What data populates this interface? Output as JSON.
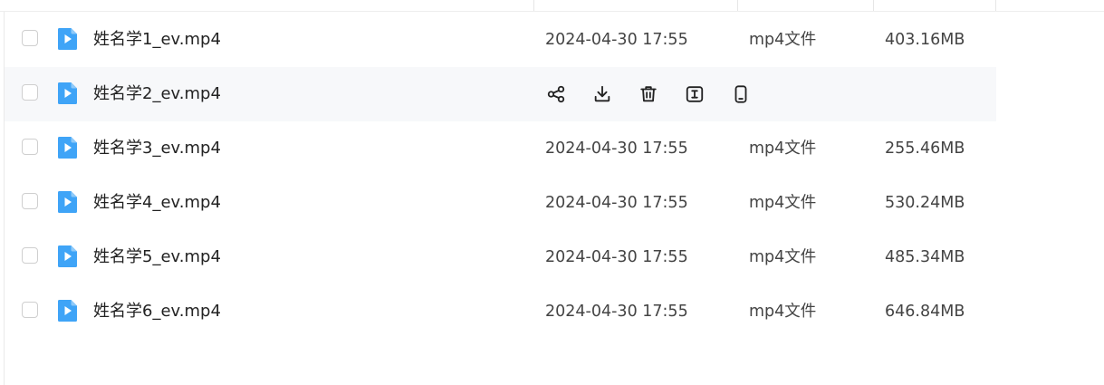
{
  "files": [
    {
      "name": "姓名学1_ev.mp4",
      "date": "2024-04-30 17:55",
      "type": "mp4文件",
      "size": "403.16MB",
      "hovered": false
    },
    {
      "name": "姓名学2_ev.mp4",
      "date": "",
      "type": "",
      "size": "",
      "hovered": true
    },
    {
      "name": "姓名学3_ev.mp4",
      "date": "2024-04-30 17:55",
      "type": "mp4文件",
      "size": "255.46MB",
      "hovered": false
    },
    {
      "name": "姓名学4_ev.mp4",
      "date": "2024-04-30 17:55",
      "type": "mp4文件",
      "size": "530.24MB",
      "hovered": false
    },
    {
      "name": "姓名学5_ev.mp4",
      "date": "2024-04-30 17:55",
      "type": "mp4文件",
      "size": "485.34MB",
      "hovered": false
    },
    {
      "name": "姓名学6_ev.mp4",
      "date": "2024-04-30 17:55",
      "type": "mp4文件",
      "size": "646.84MB",
      "hovered": false
    }
  ],
  "row_actions": [
    {
      "icon": "share-icon"
    },
    {
      "icon": "download-icon"
    },
    {
      "icon": "trash-icon"
    },
    {
      "icon": "rename-icon"
    },
    {
      "icon": "phone-icon"
    }
  ],
  "colors": {
    "file_icon": "#3fa4f7",
    "hover_row": "#f7f8fa"
  }
}
